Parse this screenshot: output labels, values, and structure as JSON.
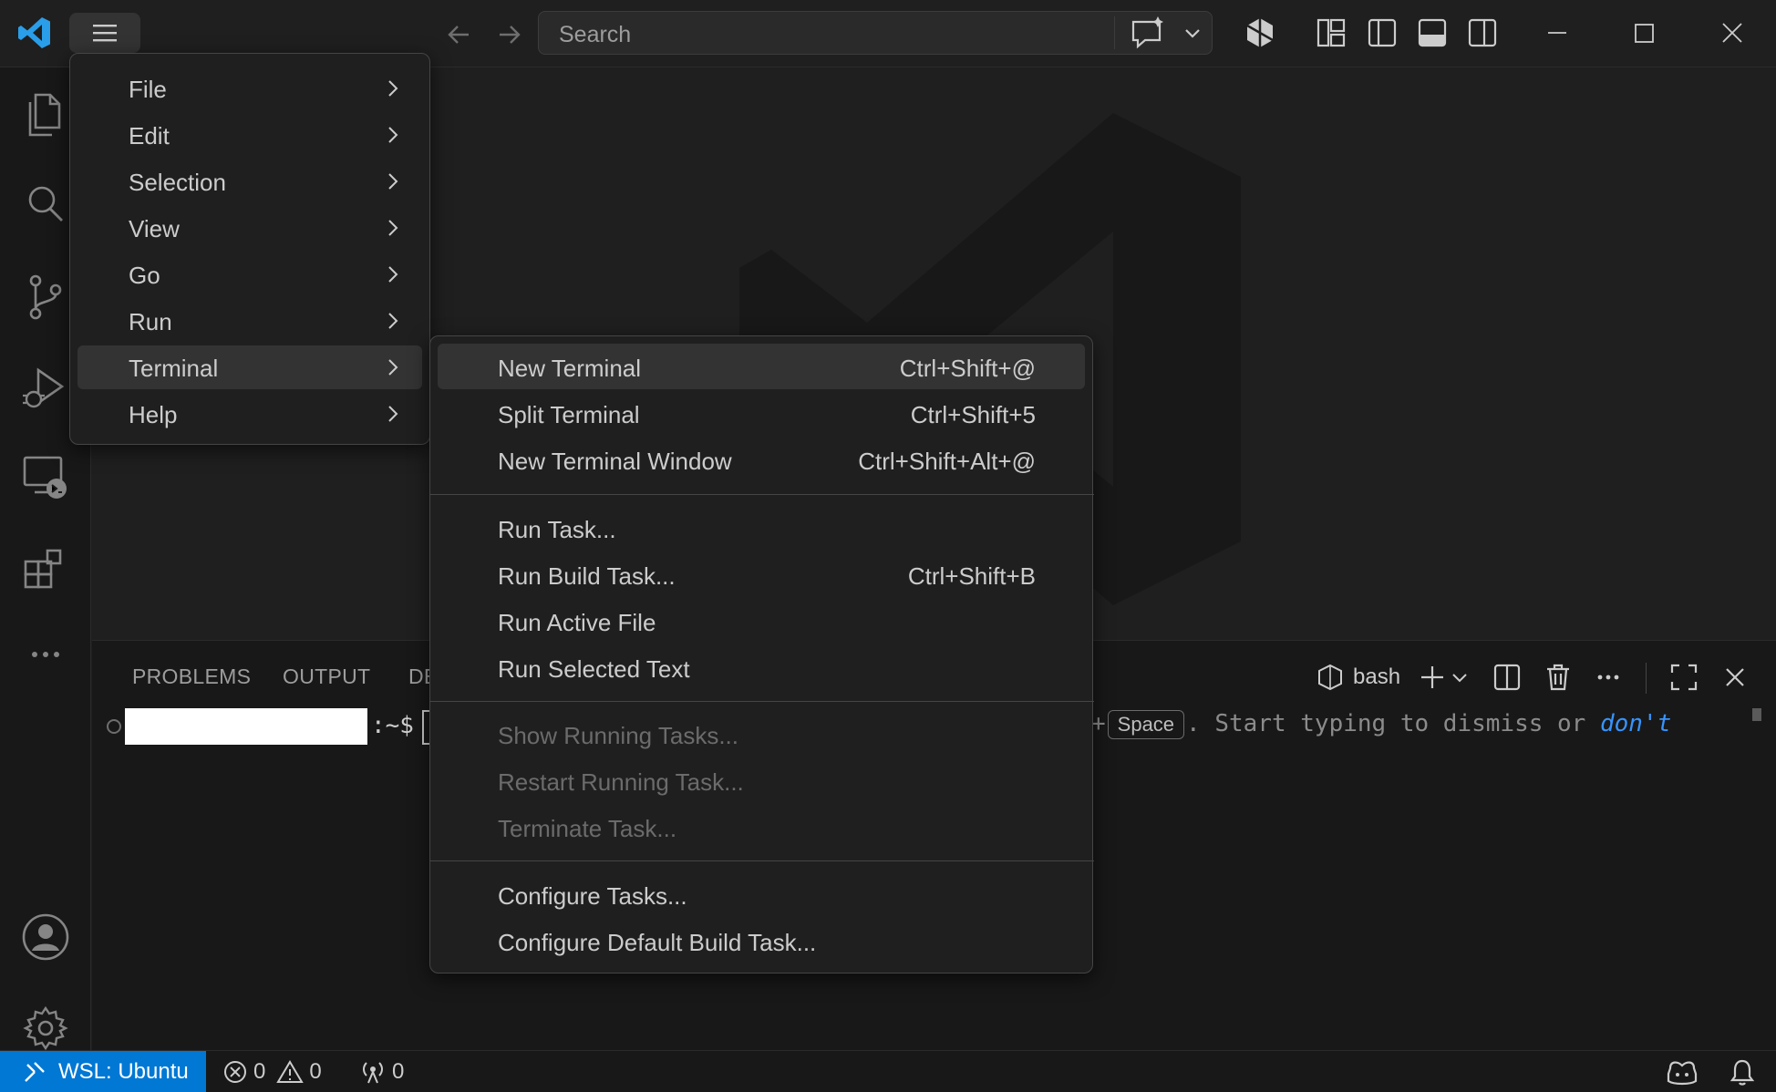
{
  "titlebar": {
    "search_placeholder": "Search",
    "icons": [
      "vscode-logo",
      "menu-icon",
      "arrow-left-icon",
      "arrow-right-icon",
      "copilot-chat-icon",
      "chevron-down-icon",
      "accounts-cube-icon",
      "customize-layout-icon",
      "toggle-primary-sidebar-icon",
      "toggle-panel-icon",
      "toggle-secondary-sidebar-icon",
      "minimize-icon",
      "maximize-icon",
      "close-icon"
    ]
  },
  "activitybar": {
    "items": [
      "explorer-icon",
      "search-icon",
      "source-control-icon",
      "run-debug-icon",
      "remote-explorer-icon",
      "extensions-icon",
      "more-icon"
    ],
    "bottom": [
      "accounts-icon",
      "settings-gear-icon"
    ]
  },
  "main_menu": {
    "items": [
      {
        "label": "File"
      },
      {
        "label": "Edit"
      },
      {
        "label": "Selection"
      },
      {
        "label": "View"
      },
      {
        "label": "Go"
      },
      {
        "label": "Run"
      },
      {
        "label": "Terminal"
      },
      {
        "label": "Help"
      }
    ],
    "active": "Terminal"
  },
  "terminal_menu": {
    "items": [
      {
        "label": "New Terminal",
        "shortcut": "Ctrl+Shift+@"
      },
      {
        "label": "Split Terminal",
        "shortcut": "Ctrl+Shift+5"
      },
      {
        "label": "New Terminal Window",
        "shortcut": "Ctrl+Shift+Alt+@"
      },
      {
        "label": "Run Task...",
        "shortcut": ""
      },
      {
        "label": "Run Build Task...",
        "shortcut": "Ctrl+Shift+B"
      },
      {
        "label": "Run Active File",
        "shortcut": ""
      },
      {
        "label": "Run Selected Text",
        "shortcut": ""
      },
      {
        "label": "Show Running Tasks...",
        "shortcut": ""
      },
      {
        "label": "Restart Running Task...",
        "shortcut": ""
      },
      {
        "label": "Terminate Task...",
        "shortcut": ""
      },
      {
        "label": "Configure Tasks...",
        "shortcut": ""
      },
      {
        "label": "Configure Default Build Task...",
        "shortcut": ""
      }
    ],
    "highlighted": "New Terminal",
    "disabled": [
      "Show Running Tasks...",
      "Restart Running Task...",
      "Terminate Task..."
    ]
  },
  "panel": {
    "tabs": [
      "PROBLEMS",
      "OUTPUT",
      "DE"
    ],
    "terminal_name": "bash",
    "prompt_suffix": ":~$",
    "hint_prefix": "+",
    "hint_key": "Space",
    "hint_text": ". Start typing to dismiss or ",
    "hint_link": "don't"
  },
  "statusbar": {
    "remote": "WSL: Ubuntu",
    "errors": "0",
    "warnings": "0",
    "ports": "0"
  },
  "colors": {
    "accent": "#0078d4",
    "background": "#1f1f1f",
    "sidebar": "#181818",
    "link": "#3794ff"
  }
}
